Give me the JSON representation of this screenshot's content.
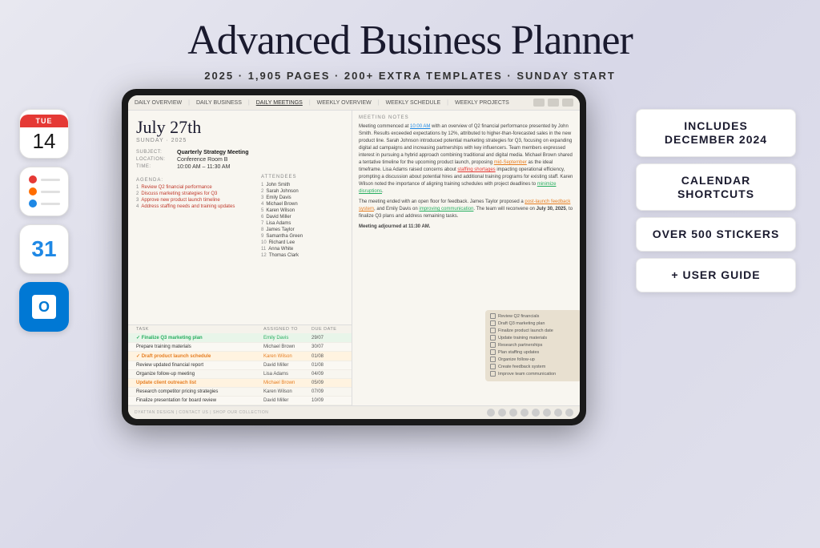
{
  "header": {
    "title": "Advanced Business Planner",
    "meta": "2025  ·  1,905 PAGES  ·  200+ EXTRA TEMPLATES  ·  SUNDAY START"
  },
  "left_icons": {
    "calendar": {
      "day": "TUE",
      "date": "14"
    },
    "reminders": {
      "label": "Reminders"
    },
    "gcal": {
      "label": "31"
    },
    "outlook": {
      "label": "O"
    }
  },
  "ipad": {
    "nav_items": [
      "DAILY OVERVIEW",
      "DAILY BUSINESS",
      "DAILY MEETINGS",
      "WEEKLY OVERVIEW",
      "WEEKLY SCHEDULE",
      "WEEKLY PROJECTS"
    ],
    "active_nav": "DAILY MEETINGS",
    "date": "July 27th",
    "date_sub": "SUNDAY · 2025",
    "subject_label": "SUBJECT:",
    "subject_value": "Quarterly Strategy Meeting",
    "location_label": "LOCATION:",
    "location_value": "Conference Room B",
    "time_label": "TIME:",
    "time_value": "10:00 AM – 11:30 AM",
    "agenda_label": "AGENDA:",
    "agenda_items": [
      "Review Q2 financial performance",
      "Discuss marketing strategies for Q3",
      "Approve new product launch timeline",
      "Address staffing needs and training updates"
    ],
    "attendees_label": "ATTENDEES",
    "attendees": [
      "John Smith",
      "Sarah Johnson",
      "Emily Davis",
      "Michael Brown",
      "Karen Wilson",
      "David Miller",
      "Lisa Adams",
      "James Taylor",
      "Samantha Green",
      "Richard Lee",
      "Anna White",
      "Thomas Clark"
    ],
    "notes_label": "MEETING NOTES",
    "notes": "Meeting commenced at 10:00 AM with an overview of Q2 financial performance presented by John Smith. Results exceeded expectations by 12%, attributed to higher-than-forecasted sales in the new product line. Sarah Johnson introduced potential marketing strategies for Q3, focusing on expanding digital ad campaigns and increasing partnerships with key influencers. Team members expressed interest in pursuing a hybrid approach combining traditional and digital media. Michael Brown shared a tentative timeline for the upcoming product launch, proposing mid-September as the ideal timeframe. Lisa Adams raised concerns about staffing shortages impacting operational efficiency, prompting a discussion about potential hires and additional training programs for existing staff. Karen Wilson noted the importance of aligning training schedules with project deadlines to minimize disruptions.\n\nThe meeting ended with an open floor for feedback. James Taylor proposed a post-launch feedback system, and Emily Davis on improving communication. The team will reconvene on July 30, 2025, to finalize Q3 plans and address remaining tasks.\n\nMeeting adjourned at 11:30 AM.",
    "tasks_cols": [
      "TASK",
      "ASSIGNED TO",
      "DUE DATE"
    ],
    "tasks": [
      {
        "name": "✓ Finalize Q3 marketing plan",
        "assigned": "Emily Davis",
        "due": "29/07",
        "style": "green"
      },
      {
        "name": "Prepare training materials",
        "assigned": "Michael Brown",
        "due": "30/07",
        "style": "normal"
      },
      {
        "name": "✓ Draft product launch schedule",
        "assigned": "Karen Wilson",
        "due": "01/08",
        "style": "orange"
      },
      {
        "name": "Review updated financial report",
        "assigned": "David Miller",
        "due": "01/08",
        "style": "normal"
      },
      {
        "name": "Organize follow-up meeting",
        "assigned": "Lisa Adams",
        "due": "04/09",
        "style": "normal"
      },
      {
        "name": "Update client outreach list",
        "assigned": "Michael Brown",
        "due": "05/09",
        "style": "orange-row"
      },
      {
        "name": "Research competitor pricing strategies",
        "assigned": "Karen Wilson",
        "due": "07/09",
        "style": "normal"
      },
      {
        "name": "Finalize presentation for board review",
        "assigned": "David Miller",
        "due": "10/09",
        "style": "normal"
      }
    ],
    "checklist": [
      "Review Q2 financials",
      "Draft Q3 marketing plan",
      "Finalize product launch date",
      "Update training materials",
      "Research partnerships",
      "Plan staffing updates",
      "Organize follow-up",
      "Create feedback system",
      "Improve team communication"
    ],
    "footer_text": "DYATTAN DESIGN  |  CONTACT US  |  SHOP OUR COLLECTION"
  },
  "features": [
    {
      "id": "feature-december",
      "text": "INCLUDES DECEMBER 2024",
      "color": "dark"
    },
    {
      "id": "feature-calendar",
      "text": "CALENDAR SHORTCUTS",
      "color": "dark"
    },
    {
      "id": "feature-stickers",
      "text": "OVER 500 STICKERS",
      "color": "dark"
    },
    {
      "id": "feature-guide",
      "text": "+ USER GUIDE",
      "color": "dark",
      "plus": true
    }
  ]
}
